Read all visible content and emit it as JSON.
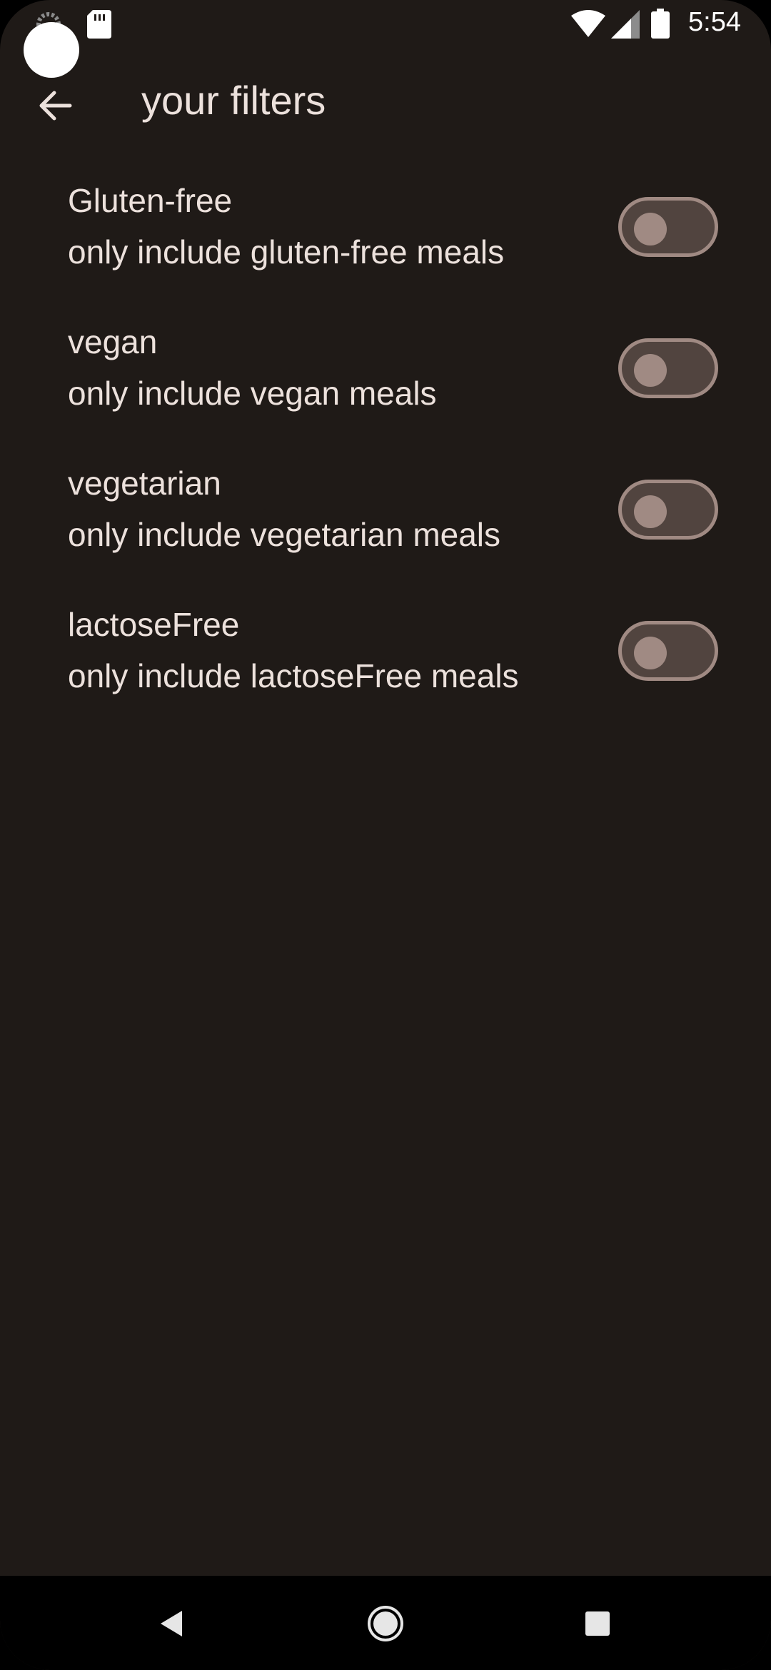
{
  "status_bar": {
    "time": "5:54",
    "icons": [
      "spinner-icon",
      "sd-card-icon",
      "wifi-icon",
      "cell-signal-icon",
      "battery-icon"
    ]
  },
  "app_bar": {
    "title": "your filters",
    "back_icon": "arrow-left-icon"
  },
  "filters": [
    {
      "title": "Gluten-free",
      "subtitle": "only include gluten-free meals",
      "enabled": false
    },
    {
      "title": "vegan",
      "subtitle": "only include vegan meals",
      "enabled": false
    },
    {
      "title": "vegetarian",
      "subtitle": "only include vegetarian meals",
      "enabled": false
    },
    {
      "title": "lactoseFree",
      "subtitle": "only include lactoseFree meals",
      "enabled": false
    }
  ],
  "nav_bar": {
    "icons": [
      "back-triangle-icon",
      "home-circle-icon",
      "recents-square-icon"
    ]
  },
  "colors": {
    "background": "#1f1a17",
    "text": "#ece1dc",
    "switch_track": "#51443f",
    "switch_outline": "#a08a83"
  }
}
